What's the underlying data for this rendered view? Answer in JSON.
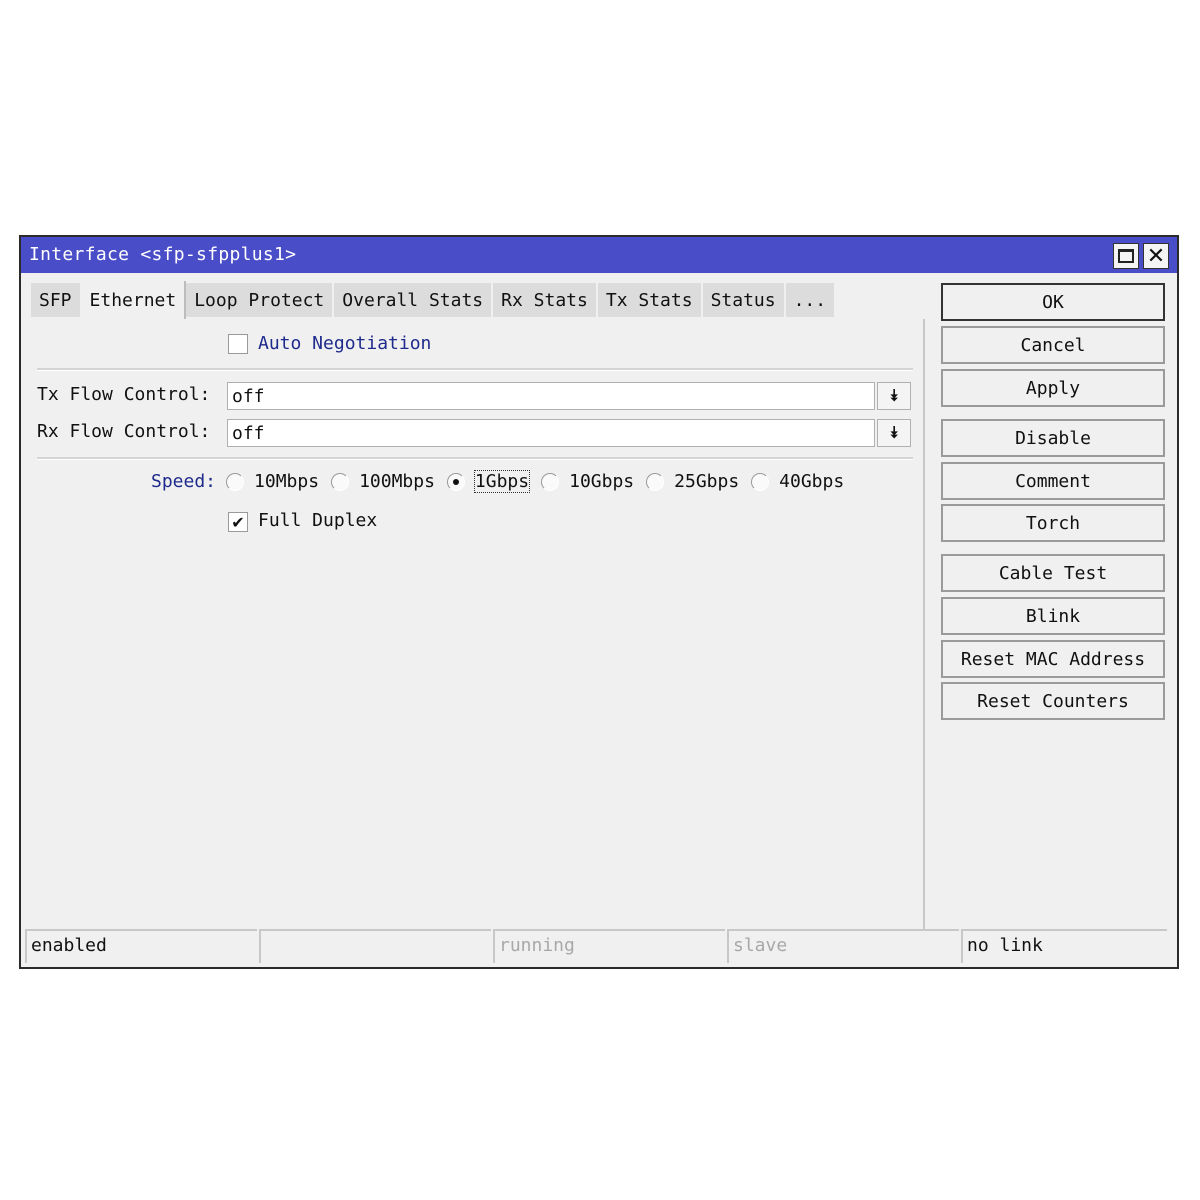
{
  "window": {
    "title": "Interface <sfp-sfpplus1>",
    "maximize_icon": "maximize-icon",
    "close_icon": "✕"
  },
  "tabs": [
    {
      "label": "SFP",
      "active": false
    },
    {
      "label": "Ethernet",
      "active": true
    },
    {
      "label": "Loop Protect",
      "active": false
    },
    {
      "label": "Overall Stats",
      "active": false
    },
    {
      "label": "Rx Stats",
      "active": false
    },
    {
      "label": "Tx Stats",
      "active": false
    },
    {
      "label": "Status",
      "active": false
    },
    {
      "label": "...",
      "active": false
    }
  ],
  "form": {
    "auto_negotiation": {
      "label": "Auto Negotiation",
      "checked": false
    },
    "tx_flow_control": {
      "label": "Tx Flow Control:",
      "value": "off"
    },
    "rx_flow_control": {
      "label": "Rx Flow Control:",
      "value": "off"
    },
    "dropdown_icon": "⯯",
    "speed": {
      "label": "Speed:",
      "options": [
        "10Mbps",
        "100Mbps",
        "1Gbps",
        "10Gbps",
        "25Gbps",
        "40Gbps"
      ],
      "selected": "1Gbps"
    },
    "full_duplex": {
      "label": "Full Duplex",
      "checked": true,
      "check_glyph": "✔"
    }
  },
  "buttons": {
    "ok": "OK",
    "cancel": "Cancel",
    "apply": "Apply",
    "disable": "Disable",
    "comment": "Comment",
    "torch": "Torch",
    "cable_test": "Cable Test",
    "blink": "Blink",
    "reset_mac": "Reset MAC Address",
    "reset_counters": "Reset Counters"
  },
  "status_bar": [
    "enabled",
    "",
    "running",
    "slave",
    "no link"
  ]
}
